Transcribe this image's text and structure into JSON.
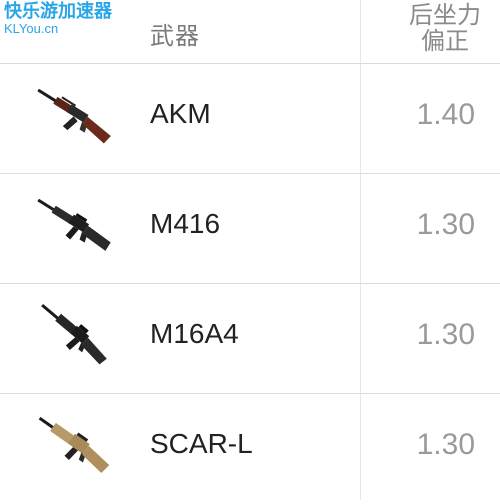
{
  "watermark": {
    "cn": "快乐游加速器",
    "en": "KLYou.cn"
  },
  "header": {
    "weapon": "武器",
    "recoil_line1": "后坐力",
    "recoil_line2": "偏正"
  },
  "rows": [
    {
      "name": "AKM",
      "value": "1.40",
      "icon": "akm-rifle-icon"
    },
    {
      "name": "M416",
      "value": "1.30",
      "icon": "m416-rifle-icon"
    },
    {
      "name": "M16A4",
      "value": "1.30",
      "icon": "m16a4-rifle-icon"
    },
    {
      "name": "SCAR-L",
      "value": "1.30",
      "icon": "scar-l-rifle-icon"
    }
  ],
  "colors": {
    "watermark": "#2aa6e8",
    "header_text": "#7a7a7a",
    "value_text": "#9a9a9a"
  }
}
